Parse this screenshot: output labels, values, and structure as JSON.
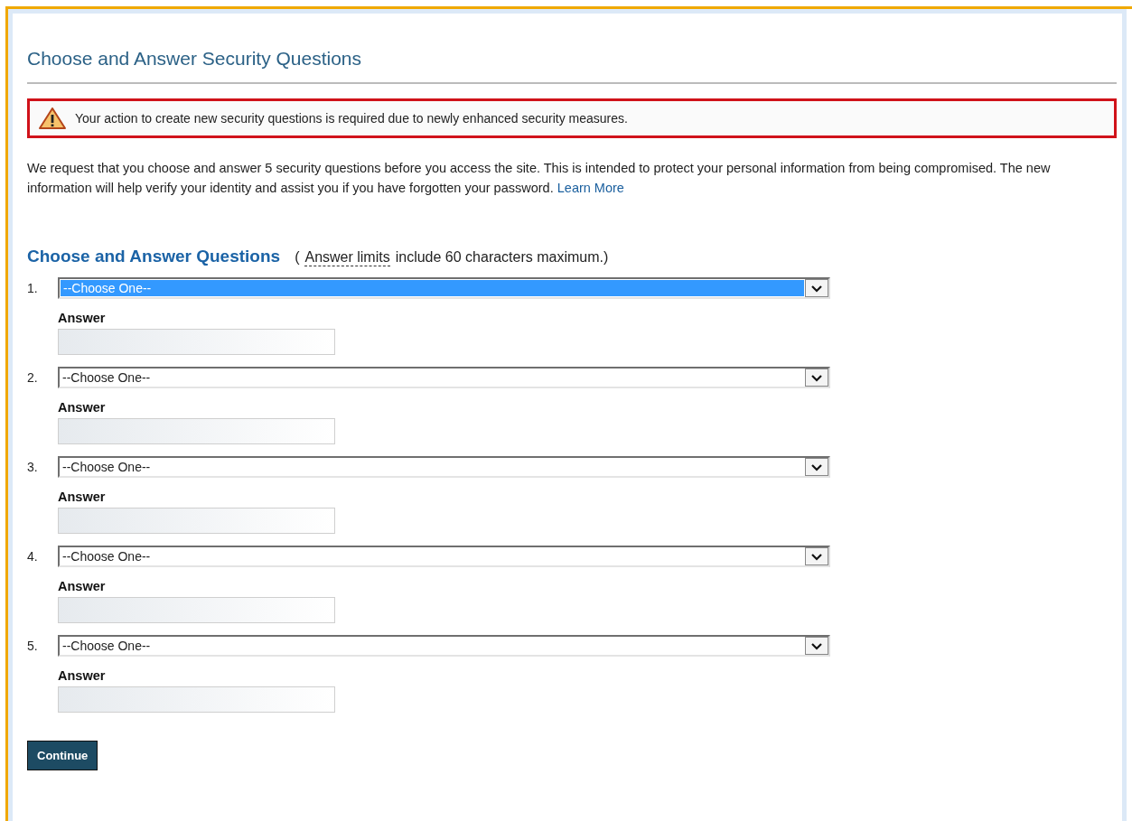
{
  "title": "Choose and Answer Security Questions",
  "alert": {
    "message": "Your action to create new security questions is required due to newly enhanced security measures."
  },
  "intro": {
    "text": "We request that you choose and answer 5 security questions before you access the site. This is intended to protect your personal information from being compromised. The new information will help verify your identity and assist you if you have forgotten your password.",
    "link": "Learn More"
  },
  "section": {
    "heading": "Choose and Answer Questions",
    "hint_open": "(",
    "hint_term": "Answer limits",
    "hint_rest": "include 60 characters maximum.)"
  },
  "questions": [
    {
      "number": "1.",
      "value": "--Choose One--",
      "highlighted": true,
      "answer_label": "Answer"
    },
    {
      "number": "2.",
      "value": "--Choose One--",
      "highlighted": false,
      "answer_label": "Answer"
    },
    {
      "number": "3.",
      "value": "--Choose One--",
      "highlighted": false,
      "answer_label": "Answer"
    },
    {
      "number": "4.",
      "value": "--Choose One--",
      "highlighted": false,
      "answer_label": "Answer"
    },
    {
      "number": "5.",
      "value": "--Choose One--",
      "highlighted": false,
      "answer_label": "Answer"
    }
  ],
  "continue_button": "Continue"
}
